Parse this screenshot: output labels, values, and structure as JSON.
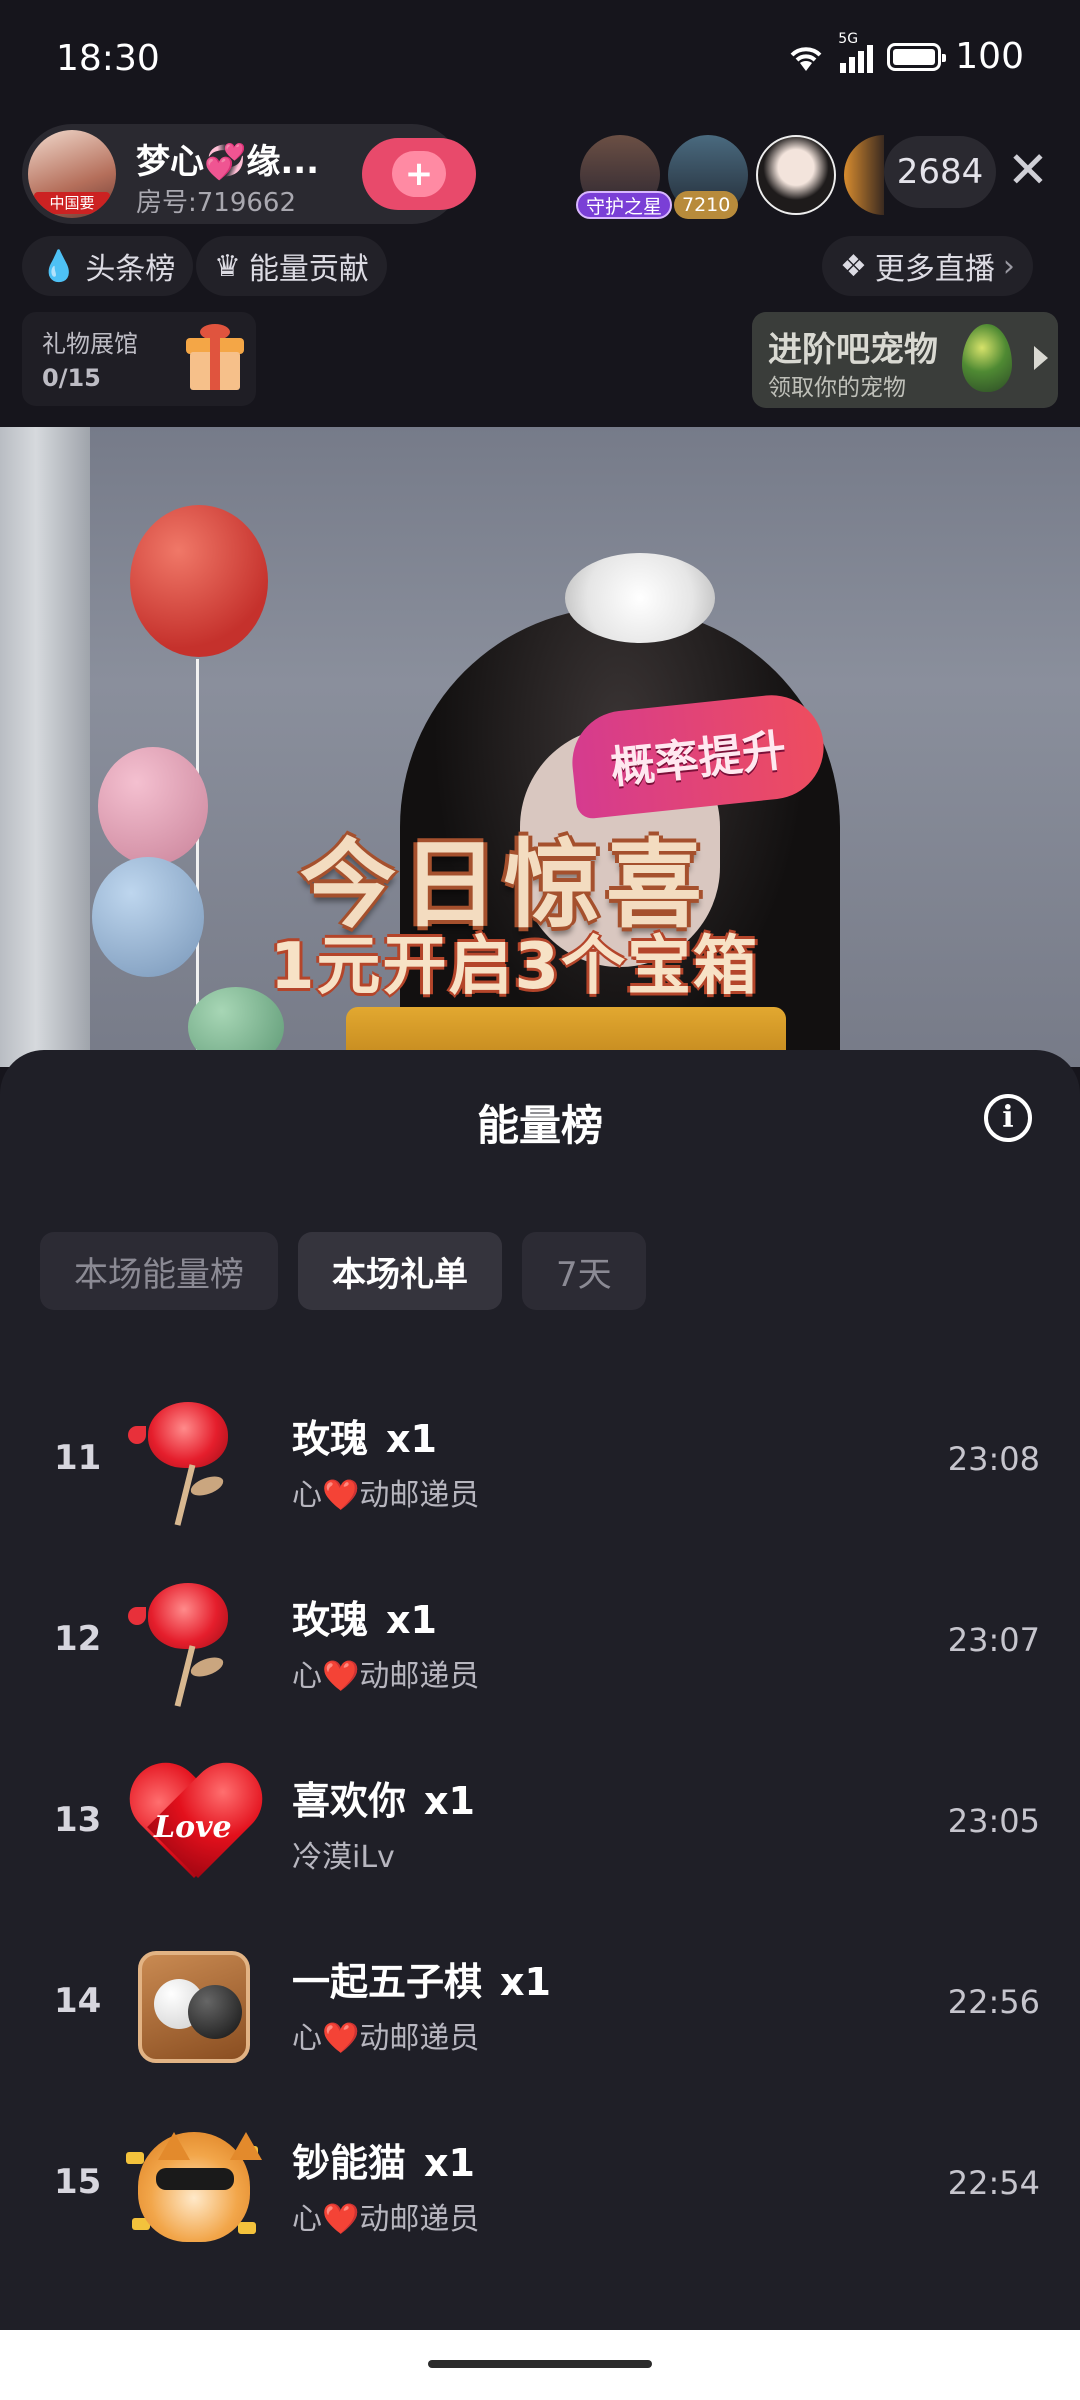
{
  "status_bar": {
    "time": "18:30",
    "signal": "5G",
    "battery": "100"
  },
  "host": {
    "name": "梦心💞缘...",
    "room": "房号:719662",
    "avatar_tag": "中国要"
  },
  "viewers": {
    "badge_guard": "守护之星",
    "badge_score": "7210",
    "count": "2684"
  },
  "tags": {
    "headline": "头条榜",
    "energy": "能量贡献",
    "more_live": "更多直播"
  },
  "gallery": {
    "title": "礼物展馆",
    "progress": "0/15"
  },
  "pet": {
    "title": "进阶吧宠物",
    "subtitle": "领取你的宠物"
  },
  "video": {
    "badge": "概率提升",
    "headline": "今日惊喜",
    "subline": "1元开启3个宝箱"
  },
  "sheet": {
    "title": "能量榜",
    "tabs": [
      {
        "label": "本场能量榜",
        "active": false
      },
      {
        "label": "本场礼单",
        "active": true
      },
      {
        "label": "7天",
        "active": false
      }
    ],
    "rows": [
      {
        "rank": "11",
        "gift": "玫瑰",
        "qty": "x1",
        "sender_prefix": "心",
        "sender_heart": "❤️",
        "sender_suffix": "动邮递员",
        "time": "23:08",
        "icon": "rose-icon"
      },
      {
        "rank": "12",
        "gift": "玫瑰",
        "qty": "x1",
        "sender_prefix": "心",
        "sender_heart": "❤️",
        "sender_suffix": "动邮递员",
        "time": "23:07",
        "icon": "rose-icon"
      },
      {
        "rank": "13",
        "gift": "喜欢你",
        "qty": "x1",
        "sender_prefix": "冷漠iLv",
        "sender_heart": "",
        "sender_suffix": "",
        "time": "23:05",
        "icon": "love-heart-icon",
        "icon_text": "Love"
      },
      {
        "rank": "14",
        "gift": "一起五子棋",
        "qty": "x1",
        "sender_prefix": "心",
        "sender_heart": "❤️",
        "sender_suffix": "动邮递员",
        "time": "22:56",
        "icon": "gomoku-icon"
      },
      {
        "rank": "15",
        "gift": "钞能猫",
        "qty": "x1",
        "sender_prefix": "心",
        "sender_heart": "❤️",
        "sender_suffix": "动邮递员",
        "time": "22:54",
        "icon": "money-cat-icon"
      }
    ]
  },
  "colors": {
    "background": "#16151c",
    "sheet": "#1f1f27",
    "accent_pink": "#e84a6b"
  }
}
